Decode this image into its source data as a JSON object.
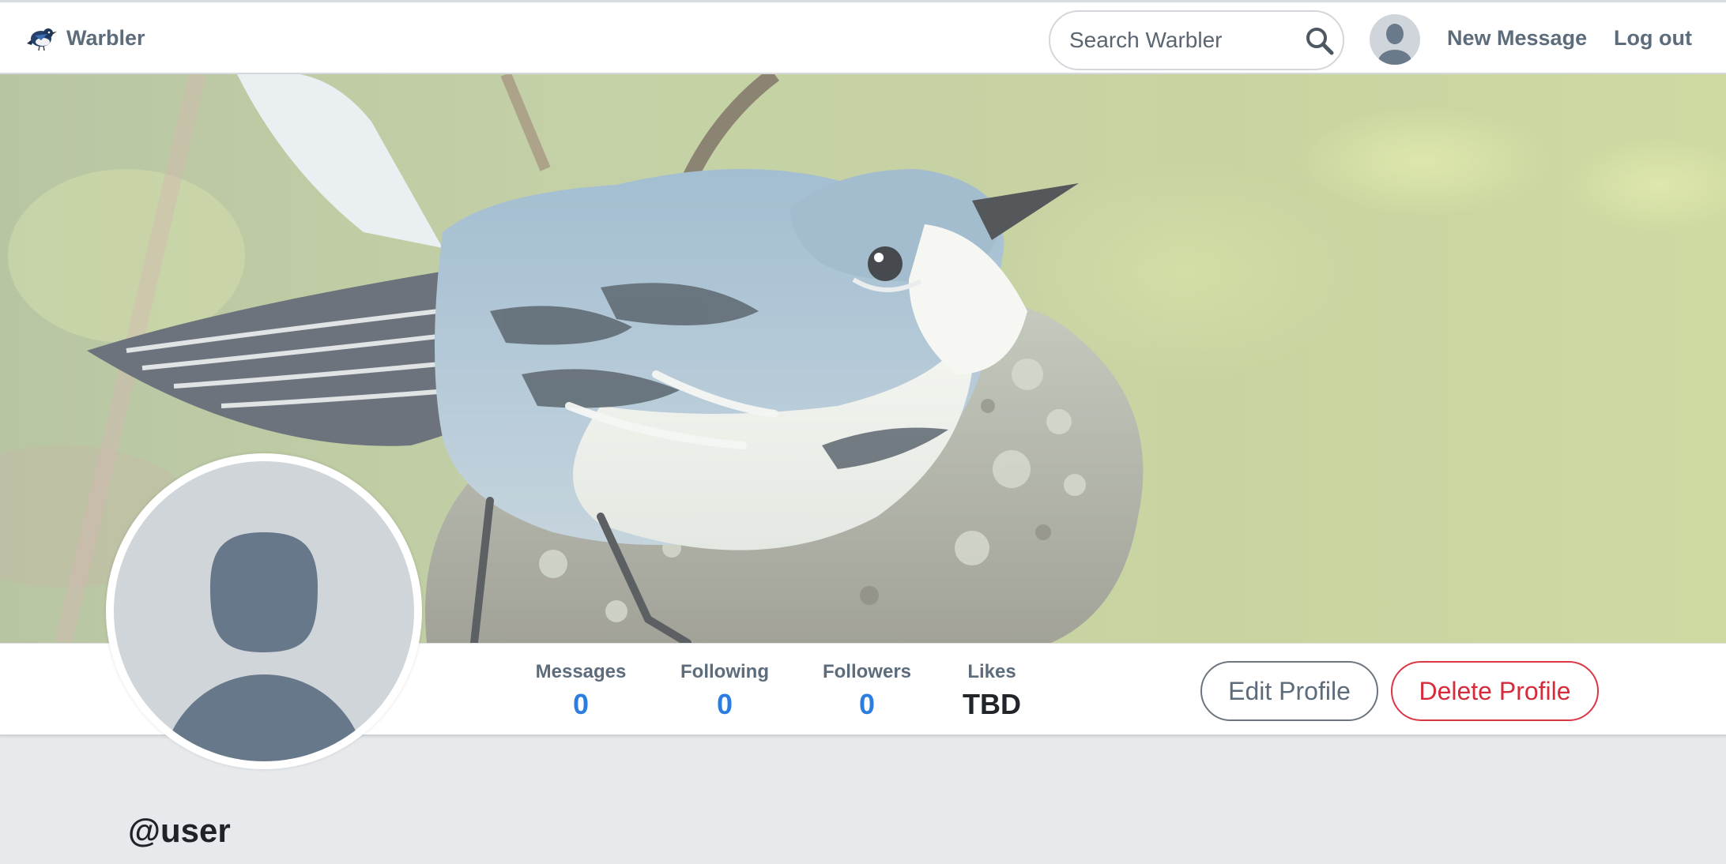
{
  "navbar": {
    "brand": "Warbler",
    "search_placeholder": "Search Warbler",
    "new_message": "New Message",
    "logout": "Log out"
  },
  "stats": [
    {
      "label": "Messages",
      "value": "0"
    },
    {
      "label": "Following",
      "value": "0"
    },
    {
      "label": "Followers",
      "value": "0"
    },
    {
      "label": "Likes",
      "value": "TBD"
    }
  ],
  "actions": {
    "edit_profile": "Edit Profile",
    "delete_profile": "Delete Profile"
  },
  "profile": {
    "username": "@user"
  },
  "colors": {
    "link_blue": "#2b7de0",
    "danger_red": "#dc3545",
    "nav_text": "#5d6c7b",
    "page_bg": "#e6eaed"
  },
  "icons": {
    "logo": "warbler-bird-logo",
    "search": "search-icon",
    "avatar": "default-user-avatar"
  }
}
